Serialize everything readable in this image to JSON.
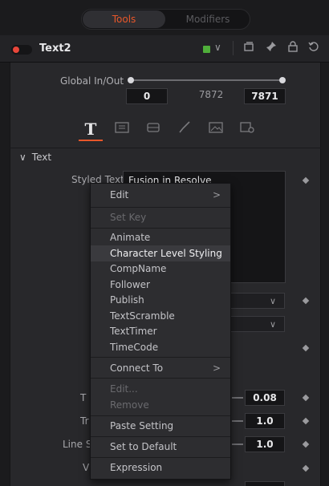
{
  "tabs": {
    "tools": "Tools",
    "modifiers": "Modifiers"
  },
  "node": {
    "name": "Text2",
    "color": "#4fae3a"
  },
  "header_icons": [
    "color-dropdown-icon",
    "pin-window-icon",
    "pin-icon",
    "lock-icon",
    "reset-icon"
  ],
  "global_inout": {
    "label": "Global In/Out",
    "start": "0",
    "mid": "7872",
    "end": "7871"
  },
  "icon_tabs": [
    "text-tab-icon",
    "layout-tab-icon",
    "transform-tab-icon",
    "shading-tab-icon",
    "image-tab-icon",
    "settings-tab-icon"
  ],
  "section": {
    "title": "Text",
    "arrow": "∨"
  },
  "styled_text": {
    "label": "Styled Text",
    "value": "Fusion in Resolve"
  },
  "rows": {
    "row1_label": "T",
    "row1_value": "0.08",
    "row2_label": "Tr",
    "row2_value": "1.0",
    "row3_label": "Line S",
    "row3_value": "1.0",
    "row4_label": "V"
  },
  "menu": {
    "edit": "Edit",
    "set_key": "Set Key",
    "animate": "Animate",
    "character_level_styling": "Character Level Styling",
    "compname": "CompName",
    "follower": "Follower",
    "publish": "Publish",
    "textscramble": "TextScramble",
    "texttimer": "TextTimer",
    "timecode": "TimeCode",
    "connect_to": "Connect To",
    "edit_ellipsis": "Edit...",
    "remove": "Remove",
    "paste_setting": "Paste Setting",
    "set_to_default": "Set to Default",
    "expression": "Expression",
    "submenu_arrow": ">"
  }
}
